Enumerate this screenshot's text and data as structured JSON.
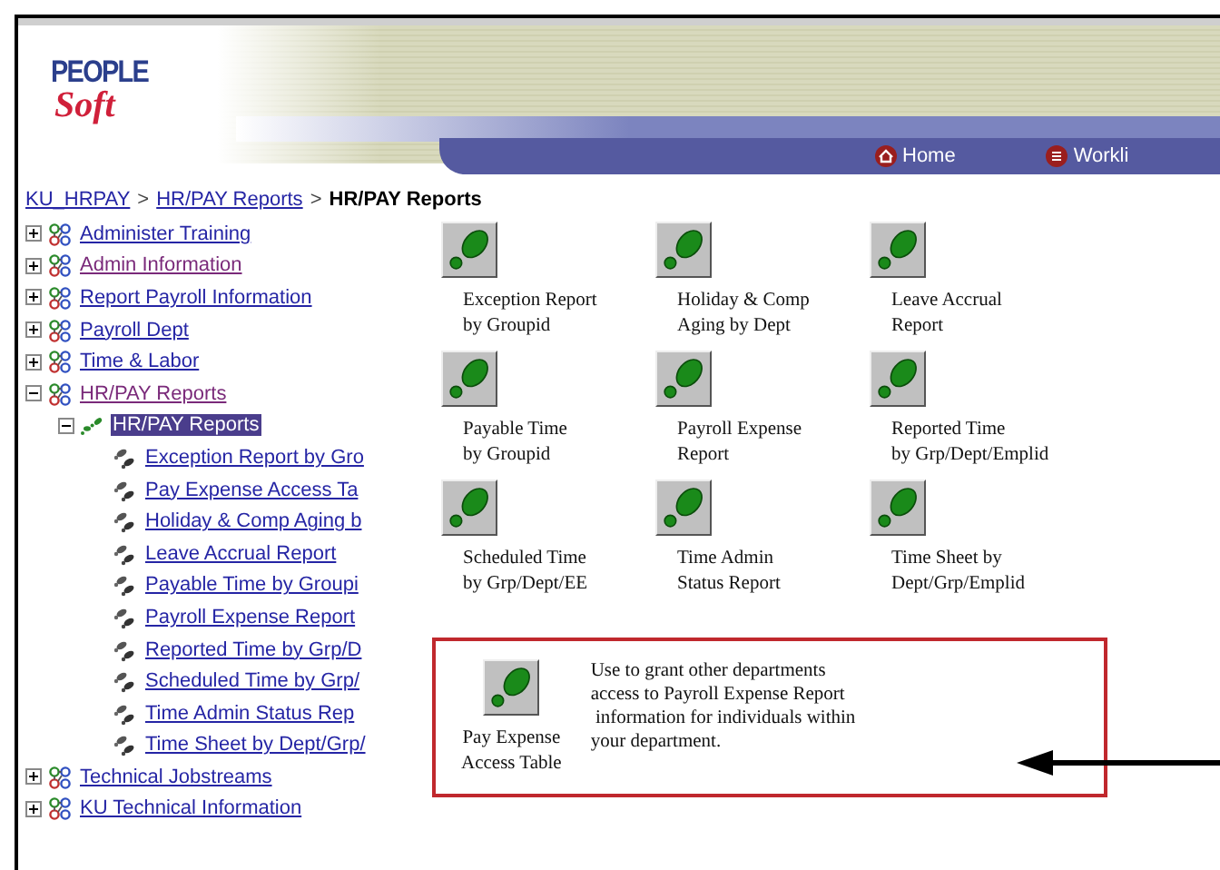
{
  "logo": {
    "top": "PEOPLE",
    "bottom": "Soft"
  },
  "nav": [
    {
      "label": "Home",
      "kind": "home"
    },
    {
      "label": "Workli",
      "kind": "worklist"
    }
  ],
  "breadcrumb": [
    {
      "label": "KU_HRPAY",
      "link": true
    },
    {
      "label": ">",
      "link": false
    },
    {
      "label": "HR/PAY Reports",
      "link": true
    },
    {
      "label": ">",
      "link": false
    },
    {
      "label": "HR/PAY Reports",
      "link": false
    }
  ],
  "tree": [
    {
      "label": "Administer Training",
      "kind": "folder",
      "expanded": false,
      "visited": false,
      "selected": false
    },
    {
      "label": "Admin Information",
      "kind": "folder",
      "expanded": false,
      "visited": true,
      "selected": false
    },
    {
      "label": "Report Payroll Information",
      "kind": "folder",
      "expanded": false,
      "visited": false,
      "selected": false
    },
    {
      "label": "Payroll Dept",
      "kind": "folder",
      "expanded": false,
      "visited": false,
      "selected": false
    },
    {
      "label": "Time & Labor",
      "kind": "folder",
      "expanded": false,
      "visited": false,
      "selected": false
    },
    {
      "label": "HR/PAY Reports",
      "kind": "folder",
      "expanded": true,
      "visited": true,
      "selected": false,
      "children": [
        {
          "label": "HR/PAY Reports",
          "kind": "group",
          "expanded": true,
          "visited": false,
          "selected": true,
          "children": [
            {
              "label": "Exception Report by Gro",
              "kind": "page",
              "visited": false,
              "selected": false
            },
            {
              "label": "Pay Expense Access Ta",
              "kind": "page",
              "visited": false,
              "selected": false
            },
            {
              "label": "Holiday & Comp Aging b",
              "kind": "page",
              "visited": false,
              "selected": false
            },
            {
              "label": "Leave Accrual Report",
              "kind": "page",
              "visited": false,
              "selected": false
            },
            {
              "label": "Payable Time by Groupi",
              "kind": "page",
              "visited": false,
              "selected": false
            },
            {
              "label": "Payroll Expense Report",
              "kind": "page",
              "visited": false,
              "selected": false
            },
            {
              "label": "Reported Time by Grp/D",
              "kind": "page",
              "visited": false,
              "selected": false
            },
            {
              "label": "Scheduled Time by Grp/",
              "kind": "page",
              "visited": false,
              "selected": false
            },
            {
              "label": "Time Admin Status Rep",
              "kind": "page",
              "visited": false,
              "selected": false
            },
            {
              "label": "Time Sheet by Dept/Grp/",
              "kind": "page",
              "visited": false,
              "selected": false
            }
          ]
        }
      ]
    },
    {
      "label": "Technical Jobstreams",
      "kind": "folder",
      "expanded": false,
      "visited": false,
      "selected": false
    },
    {
      "label": "KU Technical Information",
      "kind": "folder",
      "expanded": false,
      "visited": false,
      "selected": false
    }
  ],
  "tiles": [
    {
      "lines": [
        "Exception Report",
        "by Groupid"
      ]
    },
    {
      "lines": [
        "Holiday & Comp",
        "Aging by Dept"
      ]
    },
    {
      "lines": [
        "Leave Accrual",
        "Report"
      ]
    },
    {
      "lines": [
        "Payable Time",
        "by Groupid"
      ]
    },
    {
      "lines": [
        "Payroll Expense",
        "Report"
      ]
    },
    {
      "lines": [
        "Reported Time",
        "by Grp/Dept/Emplid"
      ]
    },
    {
      "lines": [
        "Scheduled Time",
        "by Grp/Dept/EE"
      ]
    },
    {
      "lines": [
        "Time Admin",
        "Status Report"
      ]
    },
    {
      "lines": [
        "Time Sheet by",
        "Dept/Grp/Emplid"
      ]
    }
  ],
  "callout": {
    "tile": {
      "lines": [
        "Pay Expense",
        "Access Table"
      ]
    },
    "description": [
      "Use to grant other departments",
      "access to Payroll Expense Report",
      " information for individuals within",
      "your department."
    ]
  }
}
